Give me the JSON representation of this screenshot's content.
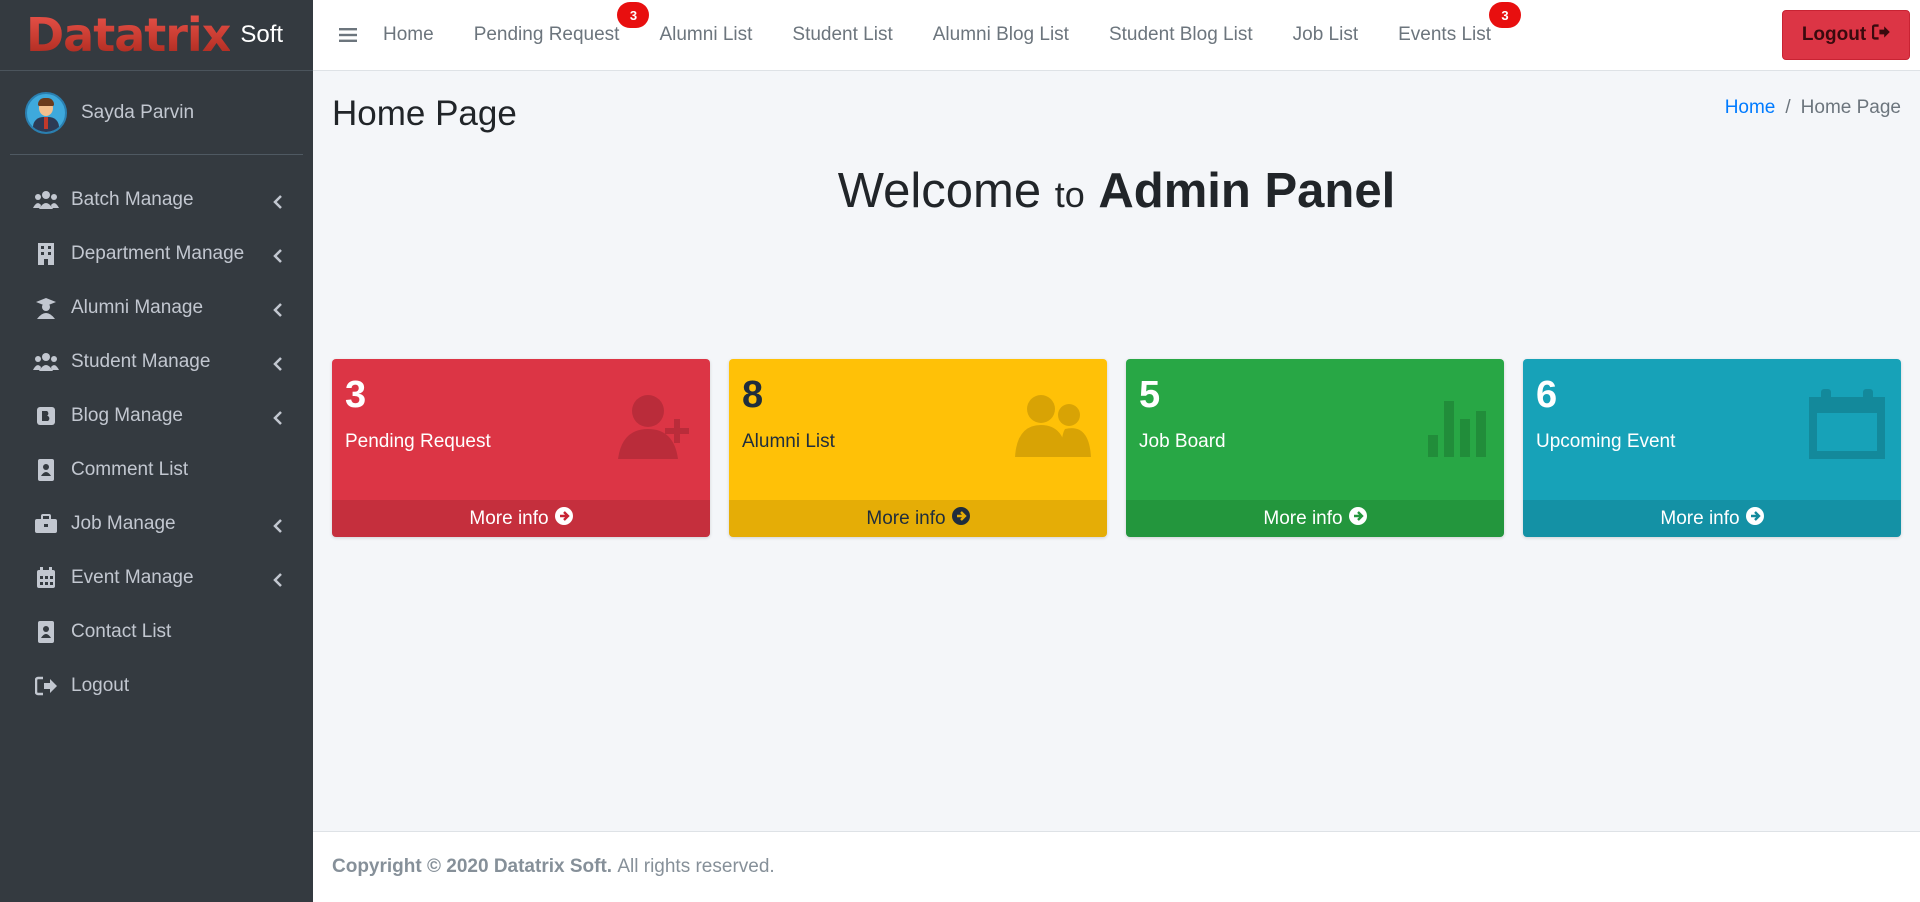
{
  "brand": {
    "logo_text": "Datatrix",
    "suffix": "Soft"
  },
  "user": {
    "name": "Sayda Parvin"
  },
  "sidebar": {
    "items": [
      {
        "label": "Batch Manage",
        "icon": "users-icon",
        "has_submenu": true
      },
      {
        "label": "Department Manage",
        "icon": "building-icon",
        "has_submenu": true
      },
      {
        "label": "Alumni Manage",
        "icon": "graduate-icon",
        "has_submenu": true
      },
      {
        "label": "Student Manage",
        "icon": "users-icon",
        "has_submenu": true
      },
      {
        "label": "Blog Manage",
        "icon": "blog-icon",
        "has_submenu": true
      },
      {
        "label": "Comment List",
        "icon": "contact-card-icon",
        "has_submenu": false
      },
      {
        "label": "Job Manage",
        "icon": "briefcase-icon",
        "has_submenu": true
      },
      {
        "label": "Event Manage",
        "icon": "calendar-icon",
        "has_submenu": true
      },
      {
        "label": "Contact List",
        "icon": "contact-card-icon",
        "has_submenu": false
      },
      {
        "label": "Logout",
        "icon": "sign-out-icon",
        "has_submenu": false
      }
    ]
  },
  "navbar": {
    "links": [
      {
        "label": "Home",
        "badge": null
      },
      {
        "label": "Pending Request",
        "badge": "3"
      },
      {
        "label": "Alumni List",
        "badge": null
      },
      {
        "label": "Student List",
        "badge": null
      },
      {
        "label": "Alumni Blog List",
        "badge": null
      },
      {
        "label": "Student Blog List",
        "badge": null
      },
      {
        "label": "Job List",
        "badge": null
      },
      {
        "label": "Events List",
        "badge": "3"
      }
    ],
    "logout_label": "Logout"
  },
  "page": {
    "title": "Home Page",
    "breadcrumb": {
      "home": "Home",
      "separator": "/",
      "current": "Home Page"
    },
    "welcome": {
      "part1": "Welcome",
      "part2": "to",
      "part3": "Admin Panel"
    }
  },
  "cards": [
    {
      "count": "3",
      "label": "Pending Request",
      "footer": "More info",
      "color": "#dc3545",
      "icon": "user-plus-icon"
    },
    {
      "count": "8",
      "label": "Alumni List",
      "footer": "More info",
      "color": "#ffc107",
      "icon": "users-icon"
    },
    {
      "count": "5",
      "label": "Job Board",
      "footer": "More info",
      "color": "#28a745",
      "icon": "bar-chart-icon"
    },
    {
      "count": "6",
      "label": "Upcoming Event",
      "footer": "More info",
      "color": "#17a2b8",
      "icon": "calendar-icon"
    }
  ],
  "footer": {
    "copyright": "Copyright © 2020 Datatrix Soft.",
    "rights": "All rights reserved."
  }
}
